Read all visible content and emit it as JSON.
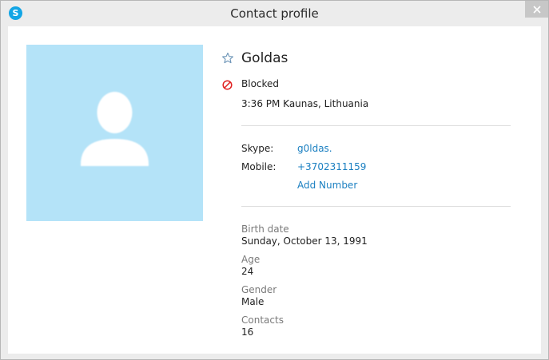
{
  "window": {
    "title": "Contact profile",
    "app_icon": "skype-icon",
    "app_icon_letter": "S"
  },
  "profile": {
    "name": "Goldas",
    "favorite_icon": "star-outline-icon",
    "status_icon": "blocked-icon",
    "status": "Blocked",
    "local_time_location": "3:36 PM Kaunas, Lithuania",
    "avatar_icon": "default-avatar-icon"
  },
  "contact": {
    "skype_label": "Skype:",
    "skype_value": "g0ldas.",
    "mobile_label": "Mobile:",
    "mobile_value": "+3702311159",
    "add_number": "Add Number"
  },
  "details": [
    {
      "label": "Birth date",
      "value": "Sunday, October 13, 1991"
    },
    {
      "label": "Age",
      "value": "24"
    },
    {
      "label": "Gender",
      "value": "Male"
    },
    {
      "label": "Contacts",
      "value": "16"
    }
  ],
  "colors": {
    "link": "#1a7fc1",
    "avatar_bg": "#b4e3f8",
    "blocked": "#e02020",
    "skype_brand": "#12a5e5"
  }
}
